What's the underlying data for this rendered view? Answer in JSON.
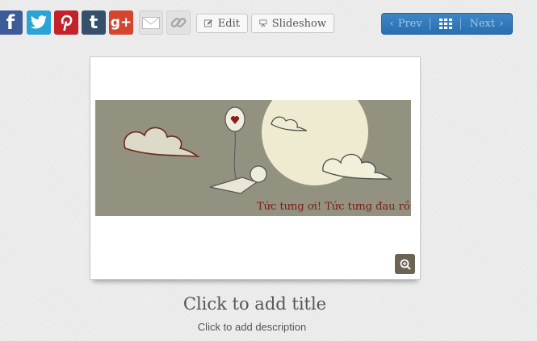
{
  "share": {
    "facebook": {
      "icon": "facebook-icon",
      "glyph": "f",
      "color": "#3b5b99"
    },
    "twitter": {
      "icon": "twitter-icon",
      "color": "#2aa3d6"
    },
    "pinterest": {
      "icon": "pinterest-icon",
      "color": "#c4222a"
    },
    "tumblr": {
      "icon": "tumblr-icon",
      "glyph": "t",
      "color": "#36506c"
    },
    "googleplus": {
      "icon": "google-plus-icon",
      "glyph": "g+",
      "color": "#d2452f"
    },
    "email": {
      "icon": "envelope-icon"
    },
    "link": {
      "icon": "chain-link-icon"
    }
  },
  "toolbar": {
    "edit_label": "Edit",
    "slideshow_label": "Slideshow"
  },
  "nav": {
    "prev_label": "Prev",
    "next_label": "Next",
    "grid_icon": "grid-icon",
    "accent": "#2f77b9"
  },
  "photo": {
    "overlay_text": "Tức tưng ơi! Tức tưng đau rồi",
    "zoom_icon": "zoom-in-icon"
  },
  "caption": {
    "title": "Click to add title",
    "description": "Click to add description"
  }
}
